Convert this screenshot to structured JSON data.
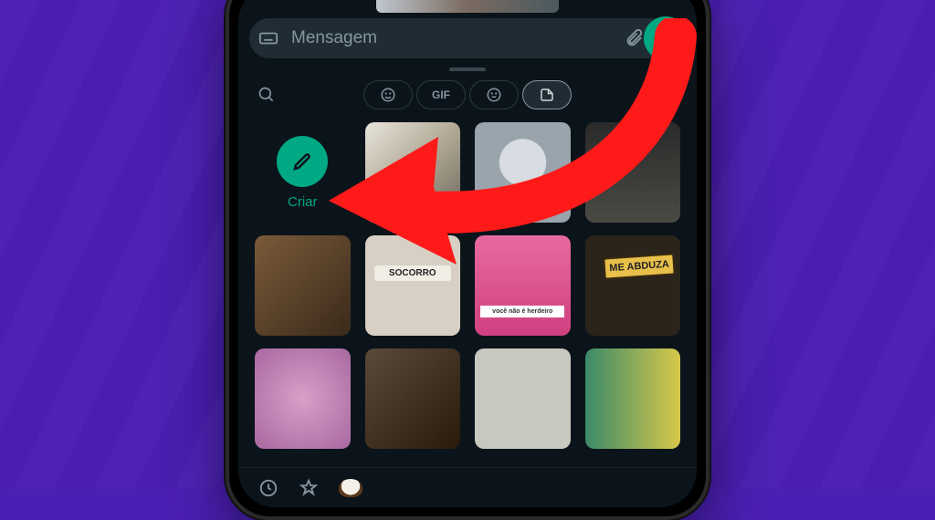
{
  "colors": {
    "background": "#4a1fb3",
    "screen": "#0b141a",
    "inputbar": "#1f2c34",
    "accent": "#00a884",
    "muted": "#8696a0",
    "arrow": "#ff1a1a"
  },
  "input": {
    "placeholder": "Mensagem"
  },
  "tabs": {
    "gif_label": "GIF",
    "active_index": 3
  },
  "create": {
    "label": "Criar"
  },
  "stickers": {
    "row2": {
      "socorro": "SOCORRO",
      "herdeiro": "você não é herdeiro",
      "abduza": "ME ABDUZA"
    }
  }
}
